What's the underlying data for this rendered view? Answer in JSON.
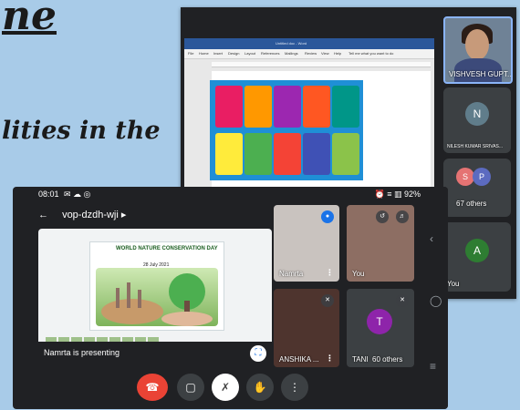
{
  "background": {
    "title_fragment": "ne",
    "subtitle_fragment": "lities in the"
  },
  "back_window": {
    "word": {
      "ribbon_tabs": [
        "File",
        "Home",
        "Insert",
        "Design",
        "Layout",
        "References",
        "Mailings",
        "Review",
        "View",
        "Help",
        "Tell me what you want to do"
      ],
      "title": "Untitled doc - Word"
    },
    "main_participant": "VISHVESH GUPT...",
    "participants": [
      {
        "initial": "N",
        "name": "NILESH KUMAR SRIVAS...",
        "color": "#607d8b"
      },
      {
        "initials": [
          "S",
          "P"
        ],
        "label": "67 others",
        "colors": [
          "#e57373",
          "#5c6bc0"
        ]
      },
      {
        "initial": "A",
        "name": "You",
        "color": "#2e7d32"
      }
    ]
  },
  "front_window": {
    "status": {
      "time": "08:01",
      "battery": "92%",
      "status_icons": "✉ ☁ ◎",
      "right_icons": "⏰ ≡ ▥"
    },
    "meeting_code": "vop-dzdh-wji",
    "slide": {
      "title": "WORLD NATURE CONSERVATION DAY",
      "date": "28 July 2021"
    },
    "presenter_text": "Namrta is presenting",
    "tiles": [
      {
        "name": "Namrta",
        "bg": "#c9c3bf"
      },
      {
        "name": "You",
        "bg": "#8d6e63"
      },
      {
        "name": "ANSHIKA ...",
        "bg": "#4e342e"
      },
      {
        "name": "TANI",
        "initial": "T",
        "bg": "#3c4043",
        "avatar_color": "#8e24aa",
        "extra": "60 others"
      }
    ],
    "buttons": [
      "end-call",
      "camera",
      "microphone",
      "raise-hand",
      "more-options"
    ],
    "colors": {
      "end_call": "#ea4335",
      "accent": "#8ab4f8"
    }
  }
}
